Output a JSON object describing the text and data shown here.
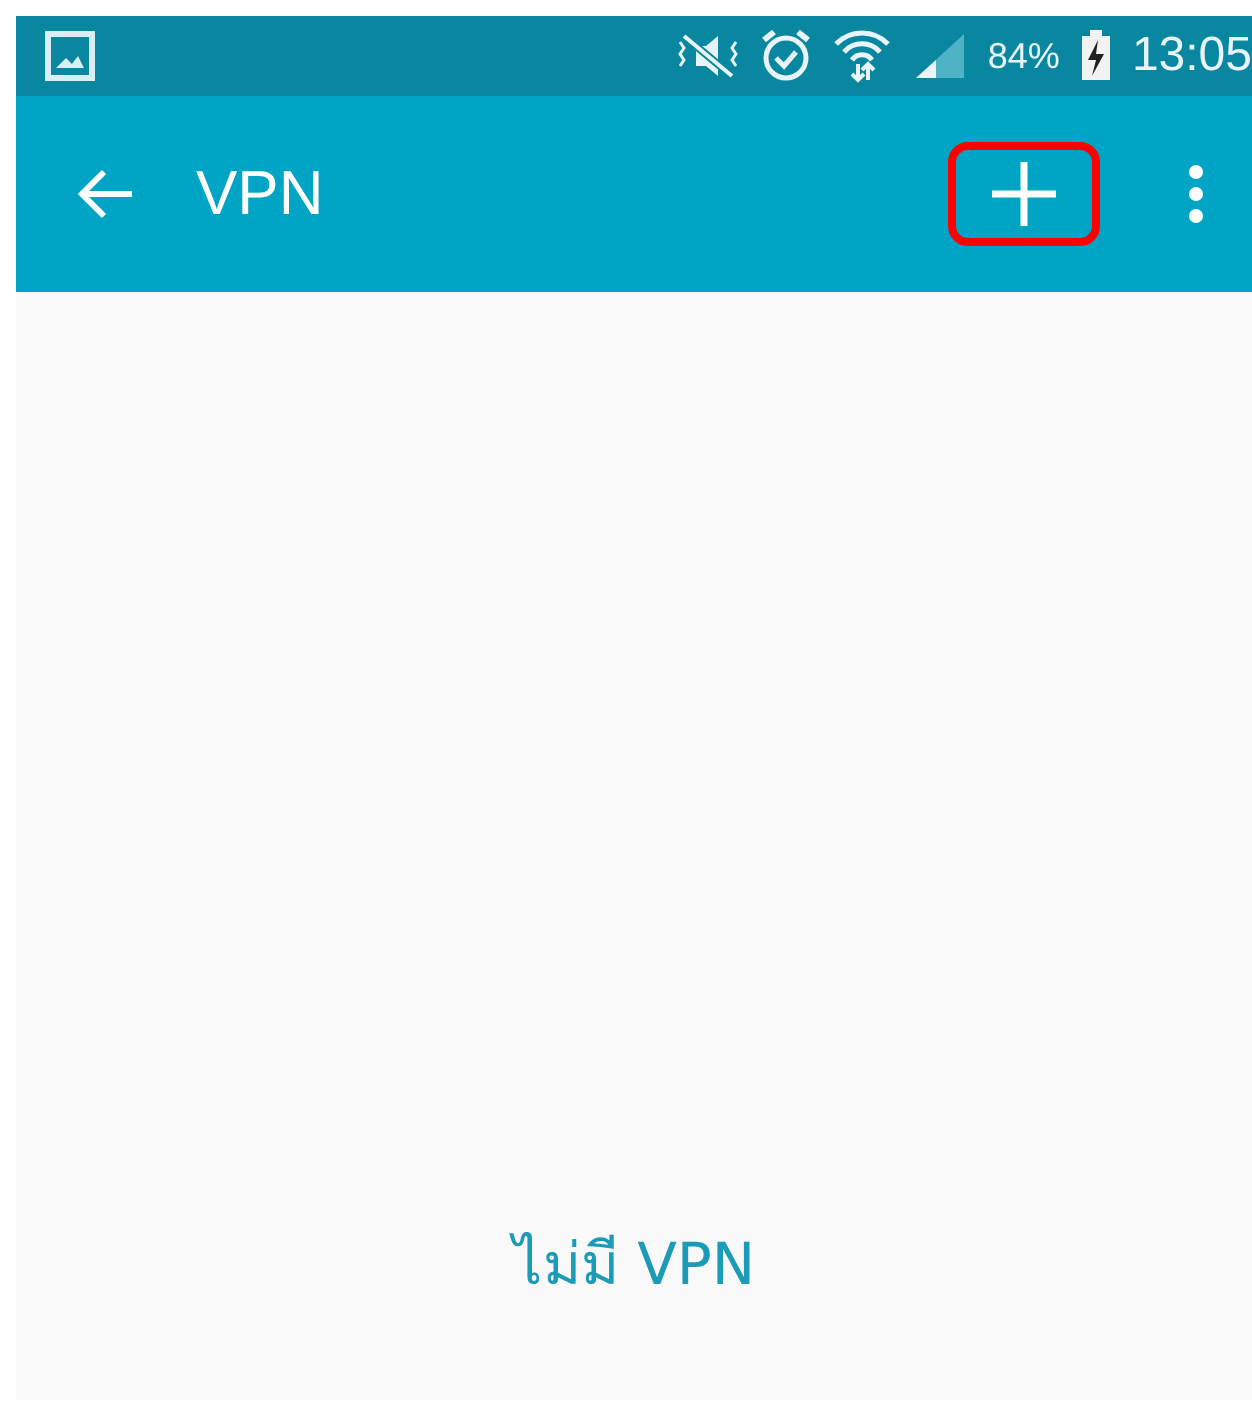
{
  "status_bar": {
    "battery": "84%",
    "time": "13:05"
  },
  "app_bar": {
    "title": "VPN",
    "actions": [
      {
        "kind": "add",
        "highlighted": true
      },
      {
        "kind": "more",
        "highlighted": false
      }
    ]
  },
  "empty_message": "ไม่มี VPN"
}
